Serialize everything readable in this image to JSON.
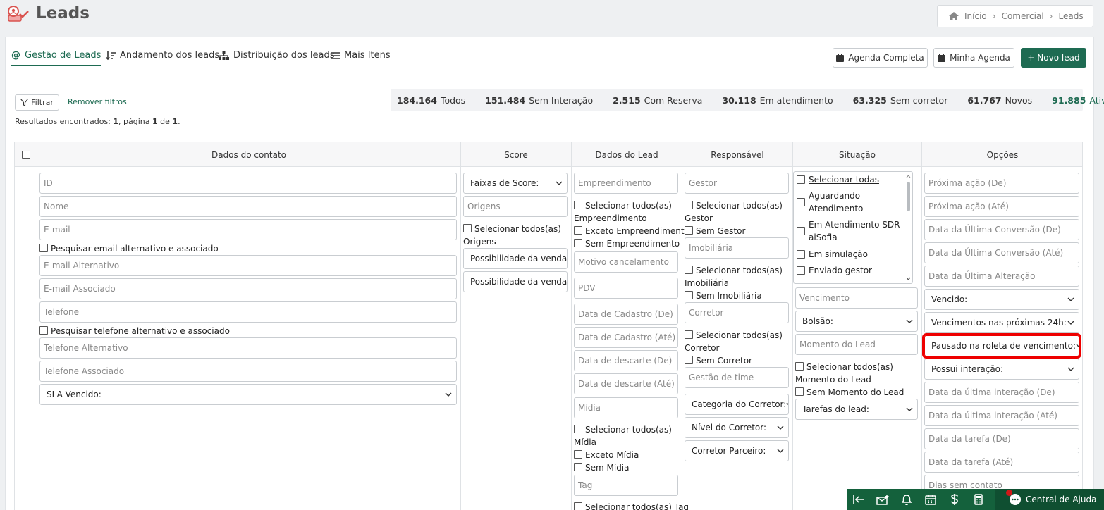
{
  "header": {
    "title": "Leads"
  },
  "breadcrumb": [
    "Início",
    "Comercial",
    "Leads"
  ],
  "tabs": [
    {
      "label": "Gestão de Leads",
      "active": true
    },
    {
      "label": "Andamento dos leads"
    },
    {
      "label": "Distribuição dos leads"
    },
    {
      "label": "Mais Itens"
    }
  ],
  "actions": {
    "agenda_completa": "Agenda Completa",
    "minha_agenda": "Minha Agenda",
    "novo_lead": "+ Novo lead"
  },
  "filters": {
    "filter_button": "Filtrar",
    "remove_filters": "Remover filtros"
  },
  "results": {
    "prefix": "Resultados encontrados:",
    "count": "1",
    "page_text": ", página",
    "page": "1",
    "of_text": "de",
    "total": "1"
  },
  "counts": [
    {
      "value": "184.164",
      "label": "Todos"
    },
    {
      "value": "151.484",
      "label": "Sem Interação"
    },
    {
      "value": "2.515",
      "label": "Com Reserva"
    },
    {
      "value": "30.118",
      "label": "Em atendimento"
    },
    {
      "value": "63.325",
      "label": "Sem corretor"
    },
    {
      "value": "61.767",
      "label": "Novos"
    },
    {
      "value": "91.885",
      "label": "Ativos"
    }
  ],
  "columns": [
    "Dados do contato",
    "Score",
    "Dados do Lead",
    "Responsável",
    "Situação",
    "Opções"
  ],
  "contato": {
    "id": "ID",
    "nome": "Nome",
    "email": "E-mail",
    "email_alt_check": "Pesquisar email alternativo e associado",
    "email_alt": "E-mail Alternativo",
    "email_assoc": "E-mail Associado",
    "telefone": "Telefone",
    "tel_alt_check": "Pesquisar telefone alternativo e associado",
    "tel_alt": "Telefone Alternativo",
    "tel_assoc": "Telefone Associado",
    "sla": "SLA Vencido:"
  },
  "score": {
    "faixas": "Faixas de Score:",
    "origens": "Origens",
    "sel_origens_1": "Selecionar todos(as)",
    "sel_origens_2": "Origens",
    "poss1": "Possibilidade da venda",
    "poss2": "Possibilidade da venda"
  },
  "lead": {
    "empreendimento": "Empreendimento",
    "sel_emp_1": "Selecionar todos(as)",
    "sel_emp_2": "Empreendimento",
    "exceto_emp": "Exceto Empreendimento",
    "sem_emp": "Sem Empreendimento",
    "motivo": "Motivo cancelamento",
    "pdv": "PDV",
    "cad_de": "Data de Cadastro (De)",
    "cad_ate": "Data de Cadastro (Até)",
    "desc_de": "Data de descarte (De)",
    "desc_ate": "Data de descarte (Até)",
    "midia": "Mídia",
    "sel_midia_1": "Selecionar todos(as)",
    "sel_midia_2": "Mídia",
    "exceto_midia": "Exceto Mídia",
    "sem_midia": "Sem Mídia",
    "tag": "Tag",
    "sel_tag": "Selecionar todos(as) Tag"
  },
  "responsavel": {
    "gestor": "Gestor",
    "sel_gestor_1": "Selecionar todos(as)",
    "sel_gestor_2": "Gestor",
    "sem_gestor": "Sem Gestor",
    "imobiliaria": "Imobiliária",
    "sel_imob_1": "Selecionar todos(as)",
    "sel_imob_2": "Imobiliária",
    "sem_imob": "Sem Imobiliária",
    "corretor": "Corretor",
    "sel_corr_1": "Selecionar todos(as)",
    "sel_corr_2": "Corretor",
    "sem_corr": "Sem Corretor",
    "gestao_time": "Gestão de time",
    "categoria": "Categoria do Corretor:",
    "nivel": "Nível do Corretor:",
    "parceiro": "Corretor Parceiro:"
  },
  "situacao": {
    "list": [
      "Selecionar todas",
      "Aguardando",
      "Atendimento",
      "Em Atendimento SDR",
      "aiSofia",
      "Em simulação",
      "Enviado gestor"
    ],
    "vencimento": "Vencimento",
    "bolsao": "Bolsão:",
    "momento": "Momento do Lead",
    "sel_mom_1": "Selecionar todos(as)",
    "sel_mom_2": "Momento do Lead",
    "sem_mom": "Sem Momento do Lead",
    "tarefas": "Tarefas do lead:"
  },
  "opcoes": {
    "prox_de": "Próxima ação (De)",
    "prox_ate": "Próxima ação (Até)",
    "conv_de": "Data da Última Conversão (De)",
    "conv_ate": "Data da Última Conversão (Até)",
    "alteracao": "Data da Última Alteração",
    "vencido": "Vencido:",
    "venc24": "Vencimentos nas próximas 24h:",
    "pausado": "Pausado na roleta de vencimento:",
    "interacao": "Possui interação:",
    "int_de": "Data da última interação (De)",
    "int_ate": "Data da última interação (Até)",
    "tarefa_de": "Data da tarefa (De)",
    "tarefa_ate": "Data da tarefa (Até)",
    "dias": "Dias sem contato"
  },
  "bottom": {
    "help": "Central de Ajuda"
  },
  "colors": {
    "accent": "#1e6b52",
    "highlight": "#e00000",
    "bottombar": "#14613c"
  }
}
